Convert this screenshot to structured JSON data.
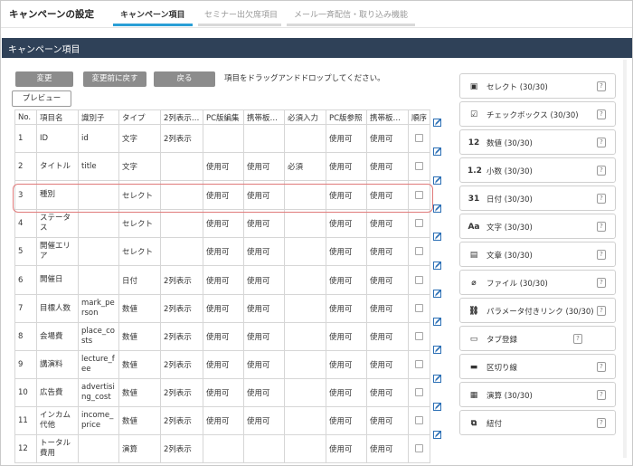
{
  "header": {
    "app_title": "キャンペーンの設定",
    "tabs": [
      {
        "label": "キャンペーン項目",
        "active": true
      },
      {
        "label": "セミナー出欠席項目",
        "active": false
      },
      {
        "label": "メール一斉配信・取り込み機能",
        "active": false
      }
    ]
  },
  "section": {
    "title": "キャンペーン項目"
  },
  "toolbar": {
    "change": "変更",
    "revert": "変更前に戻す",
    "back": "戻る",
    "hint": "項目をドラッグアンドドロップしてください。",
    "preview": "プレビュー"
  },
  "table": {
    "headers": [
      "No.",
      "項目名",
      "識別子",
      "タイプ",
      "2列表示…",
      "PC版編集",
      "携帯板…",
      "必須入力",
      "PC版参照",
      "携帯板…",
      "順序"
    ],
    "rows": [
      {
        "no": "1",
        "name": "ID",
        "ident": "id",
        "type": "文字",
        "col2": "2列表示",
        "pcedit": "",
        "mobedit": "",
        "req": "",
        "pcview": "使用可",
        "mobview": "使用可"
      },
      {
        "no": "2",
        "name": "タイトル",
        "ident": "title",
        "type": "文字",
        "col2": "",
        "pcedit": "使用可",
        "mobedit": "使用可",
        "req": "必須",
        "pcview": "使用可",
        "mobview": "使用可"
      },
      {
        "no": "3",
        "name": "種別",
        "ident": "",
        "type": "セレクト",
        "col2": "",
        "pcedit": "使用可",
        "mobedit": "使用可",
        "req": "",
        "pcview": "使用可",
        "mobview": "使用可"
      },
      {
        "no": "4",
        "name": "ステータス",
        "ident": "",
        "type": "セレクト",
        "col2": "",
        "pcedit": "使用可",
        "mobedit": "使用可",
        "req": "",
        "pcview": "使用可",
        "mobview": "使用可"
      },
      {
        "no": "5",
        "name": "開催エリア",
        "ident": "",
        "type": "セレクト",
        "col2": "",
        "pcedit": "使用可",
        "mobedit": "使用可",
        "req": "",
        "pcview": "使用可",
        "mobview": "使用可"
      },
      {
        "no": "6",
        "name": "開催日",
        "ident": "",
        "type": "日付",
        "col2": "2列表示",
        "pcedit": "使用可",
        "mobedit": "使用可",
        "req": "",
        "pcview": "使用可",
        "mobview": "使用可"
      },
      {
        "no": "7",
        "name": "目標人数",
        "ident": "mark_person",
        "type": "数値",
        "col2": "2列表示",
        "pcedit": "使用可",
        "mobedit": "使用可",
        "req": "",
        "pcview": "使用可",
        "mobview": "使用可"
      },
      {
        "no": "8",
        "name": "会場費",
        "ident": "place_costs",
        "type": "数値",
        "col2": "2列表示",
        "pcedit": "使用可",
        "mobedit": "使用可",
        "req": "",
        "pcview": "使用可",
        "mobview": "使用可"
      },
      {
        "no": "9",
        "name": "講演料",
        "ident": "lecture_fee",
        "type": "数値",
        "col2": "2列表示",
        "pcedit": "使用可",
        "mobedit": "使用可",
        "req": "",
        "pcview": "使用可",
        "mobview": "使用可"
      },
      {
        "no": "10",
        "name": "広告費",
        "ident": "advertising_cost",
        "type": "数値",
        "col2": "2列表示",
        "pcedit": "使用可",
        "mobedit": "使用可",
        "req": "",
        "pcview": "使用可",
        "mobview": "使用可"
      },
      {
        "no": "11",
        "name": "インカム代他",
        "ident": "income_price",
        "type": "数値",
        "col2": "2列表示",
        "pcedit": "使用可",
        "mobedit": "使用可",
        "req": "",
        "pcview": "使用可",
        "mobview": "使用可"
      },
      {
        "no": "12",
        "name": "トータル費用",
        "ident": "",
        "type": "演算",
        "col2": "2列表示",
        "pcedit": "",
        "mobedit": "",
        "req": "",
        "pcview": "使用可",
        "mobview": "使用可"
      }
    ]
  },
  "palette": [
    {
      "label": "セレクト (30/30)",
      "icon": "select-icon",
      "glyph": "▣"
    },
    {
      "label": "チェックボックス (30/30)",
      "icon": "checkbox-icon",
      "glyph": "☑"
    },
    {
      "label": "数値 (30/30)",
      "icon": "number-icon",
      "glyph": "12"
    },
    {
      "label": "小数 (30/30)",
      "icon": "decimal-icon",
      "glyph": "1.2"
    },
    {
      "label": "日付 (30/30)",
      "icon": "calendar-icon",
      "glyph": "31"
    },
    {
      "label": "文字 (30/30)",
      "icon": "text-icon",
      "glyph": "Aa"
    },
    {
      "label": "文章 (30/30)",
      "icon": "document-icon",
      "glyph": "▤"
    },
    {
      "label": "ファイル (30/30)",
      "icon": "paperclip-icon",
      "glyph": "⌀"
    },
    {
      "label": "パラメータ付きリンク (30/30)",
      "icon": "link-icon",
      "glyph": "⛓"
    },
    {
      "label": "タブ登録",
      "icon": "tab-icon",
      "glyph": "▭"
    },
    {
      "label": "区切り線",
      "icon": "divider-icon",
      "glyph": "▬"
    },
    {
      "label": "演算 (30/30)",
      "icon": "calculator-icon",
      "glyph": "▦"
    },
    {
      "label": "紐付",
      "icon": "relation-icon",
      "glyph": "⧉"
    }
  ],
  "help_glyph": "?",
  "colors": {
    "accent": "#2a9fd6",
    "section_bg": "#2f4158",
    "button_gray": "#8c8c8c",
    "highlight": "#e07a7a",
    "edit_icon": "#2b6fb5"
  }
}
